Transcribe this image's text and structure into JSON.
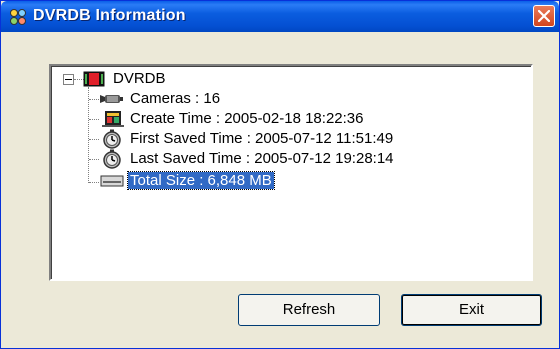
{
  "window": {
    "title": "DVRDB Information"
  },
  "tree": {
    "root": {
      "label": "DVRDB",
      "icon": "dvr-database-icon"
    },
    "items": [
      {
        "label": "Cameras : 16",
        "icon": "camera-icon"
      },
      {
        "label": "Create Time : 2005-02-18 18:22:36",
        "icon": "create-time-icon"
      },
      {
        "label": "First Saved Time : 2005-07-12 11:51:49",
        "icon": "clock-icon"
      },
      {
        "label": "Last Saved Time : 2005-07-12 19:28:14",
        "icon": "clock-icon"
      },
      {
        "label": "Total Size : 6,848 MB",
        "icon": "drive-icon",
        "selected": true
      }
    ]
  },
  "buttons": {
    "refresh": "Refresh",
    "exit": "Exit"
  },
  "colors": {
    "titlebar": "#0450d3",
    "selection": "#316ac5",
    "close": "#d2451e"
  }
}
